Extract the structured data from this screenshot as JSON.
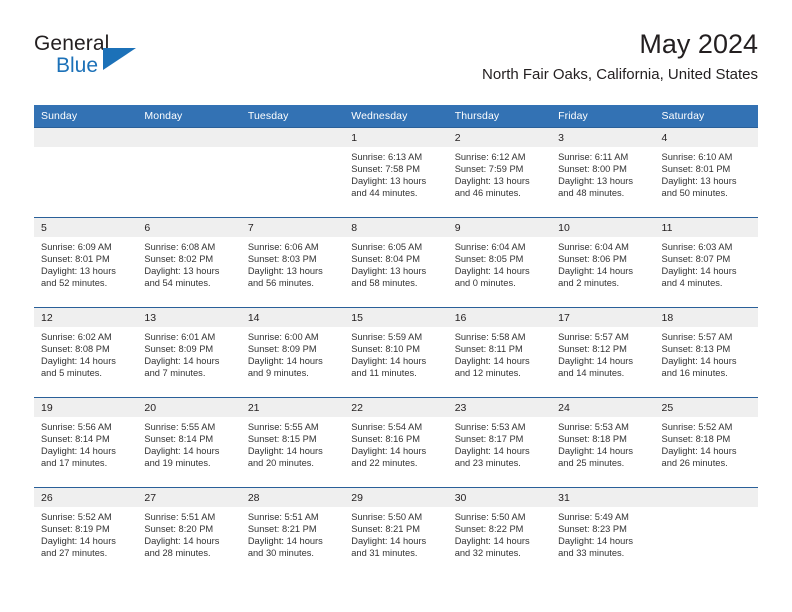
{
  "brand": {
    "name_part1": "General",
    "name_part2": "Blue"
  },
  "header": {
    "title": "May 2024",
    "subtitle": "North Fair Oaks, California, United States"
  },
  "colors": {
    "header_blue": "#3372b4",
    "row_border_blue": "#2a6099",
    "daynum_band": "#efefef",
    "brand_blue": "#1c71b8"
  },
  "weekdays": [
    "Sunday",
    "Monday",
    "Tuesday",
    "Wednesday",
    "Thursday",
    "Friday",
    "Saturday"
  ],
  "labels": {
    "sunrise": "Sunrise:",
    "sunset": "Sunset:",
    "daylight": "Daylight:"
  },
  "weeks": [
    [
      {
        "day": "",
        "sunrise": "",
        "sunset": "",
        "daylight": "",
        "empty": true
      },
      {
        "day": "",
        "sunrise": "",
        "sunset": "",
        "daylight": "",
        "empty": true
      },
      {
        "day": "",
        "sunrise": "",
        "sunset": "",
        "daylight": "",
        "empty": true
      },
      {
        "day": "1",
        "sunrise": "Sunrise: 6:13 AM",
        "sunset": "Sunset: 7:58 PM",
        "daylight": "Daylight: 13 hours and 44 minutes."
      },
      {
        "day": "2",
        "sunrise": "Sunrise: 6:12 AM",
        "sunset": "Sunset: 7:59 PM",
        "daylight": "Daylight: 13 hours and 46 minutes."
      },
      {
        "day": "3",
        "sunrise": "Sunrise: 6:11 AM",
        "sunset": "Sunset: 8:00 PM",
        "daylight": "Daylight: 13 hours and 48 minutes."
      },
      {
        "day": "4",
        "sunrise": "Sunrise: 6:10 AM",
        "sunset": "Sunset: 8:01 PM",
        "daylight": "Daylight: 13 hours and 50 minutes."
      }
    ],
    [
      {
        "day": "5",
        "sunrise": "Sunrise: 6:09 AM",
        "sunset": "Sunset: 8:01 PM",
        "daylight": "Daylight: 13 hours and 52 minutes."
      },
      {
        "day": "6",
        "sunrise": "Sunrise: 6:08 AM",
        "sunset": "Sunset: 8:02 PM",
        "daylight": "Daylight: 13 hours and 54 minutes."
      },
      {
        "day": "7",
        "sunrise": "Sunrise: 6:06 AM",
        "sunset": "Sunset: 8:03 PM",
        "daylight": "Daylight: 13 hours and 56 minutes."
      },
      {
        "day": "8",
        "sunrise": "Sunrise: 6:05 AM",
        "sunset": "Sunset: 8:04 PM",
        "daylight": "Daylight: 13 hours and 58 minutes."
      },
      {
        "day": "9",
        "sunrise": "Sunrise: 6:04 AM",
        "sunset": "Sunset: 8:05 PM",
        "daylight": "Daylight: 14 hours and 0 minutes."
      },
      {
        "day": "10",
        "sunrise": "Sunrise: 6:04 AM",
        "sunset": "Sunset: 8:06 PM",
        "daylight": "Daylight: 14 hours and 2 minutes."
      },
      {
        "day": "11",
        "sunrise": "Sunrise: 6:03 AM",
        "sunset": "Sunset: 8:07 PM",
        "daylight": "Daylight: 14 hours and 4 minutes."
      }
    ],
    [
      {
        "day": "12",
        "sunrise": "Sunrise: 6:02 AM",
        "sunset": "Sunset: 8:08 PM",
        "daylight": "Daylight: 14 hours and 5 minutes."
      },
      {
        "day": "13",
        "sunrise": "Sunrise: 6:01 AM",
        "sunset": "Sunset: 8:09 PM",
        "daylight": "Daylight: 14 hours and 7 minutes."
      },
      {
        "day": "14",
        "sunrise": "Sunrise: 6:00 AM",
        "sunset": "Sunset: 8:09 PM",
        "daylight": "Daylight: 14 hours and 9 minutes."
      },
      {
        "day": "15",
        "sunrise": "Sunrise: 5:59 AM",
        "sunset": "Sunset: 8:10 PM",
        "daylight": "Daylight: 14 hours and 11 minutes."
      },
      {
        "day": "16",
        "sunrise": "Sunrise: 5:58 AM",
        "sunset": "Sunset: 8:11 PM",
        "daylight": "Daylight: 14 hours and 12 minutes."
      },
      {
        "day": "17",
        "sunrise": "Sunrise: 5:57 AM",
        "sunset": "Sunset: 8:12 PM",
        "daylight": "Daylight: 14 hours and 14 minutes."
      },
      {
        "day": "18",
        "sunrise": "Sunrise: 5:57 AM",
        "sunset": "Sunset: 8:13 PM",
        "daylight": "Daylight: 14 hours and 16 minutes."
      }
    ],
    [
      {
        "day": "19",
        "sunrise": "Sunrise: 5:56 AM",
        "sunset": "Sunset: 8:14 PM",
        "daylight": "Daylight: 14 hours and 17 minutes."
      },
      {
        "day": "20",
        "sunrise": "Sunrise: 5:55 AM",
        "sunset": "Sunset: 8:14 PM",
        "daylight": "Daylight: 14 hours and 19 minutes."
      },
      {
        "day": "21",
        "sunrise": "Sunrise: 5:55 AM",
        "sunset": "Sunset: 8:15 PM",
        "daylight": "Daylight: 14 hours and 20 minutes."
      },
      {
        "day": "22",
        "sunrise": "Sunrise: 5:54 AM",
        "sunset": "Sunset: 8:16 PM",
        "daylight": "Daylight: 14 hours and 22 minutes."
      },
      {
        "day": "23",
        "sunrise": "Sunrise: 5:53 AM",
        "sunset": "Sunset: 8:17 PM",
        "daylight": "Daylight: 14 hours and 23 minutes."
      },
      {
        "day": "24",
        "sunrise": "Sunrise: 5:53 AM",
        "sunset": "Sunset: 8:18 PM",
        "daylight": "Daylight: 14 hours and 25 minutes."
      },
      {
        "day": "25",
        "sunrise": "Sunrise: 5:52 AM",
        "sunset": "Sunset: 8:18 PM",
        "daylight": "Daylight: 14 hours and 26 minutes."
      }
    ],
    [
      {
        "day": "26",
        "sunrise": "Sunrise: 5:52 AM",
        "sunset": "Sunset: 8:19 PM",
        "daylight": "Daylight: 14 hours and 27 minutes."
      },
      {
        "day": "27",
        "sunrise": "Sunrise: 5:51 AM",
        "sunset": "Sunset: 8:20 PM",
        "daylight": "Daylight: 14 hours and 28 minutes."
      },
      {
        "day": "28",
        "sunrise": "Sunrise: 5:51 AM",
        "sunset": "Sunset: 8:21 PM",
        "daylight": "Daylight: 14 hours and 30 minutes."
      },
      {
        "day": "29",
        "sunrise": "Sunrise: 5:50 AM",
        "sunset": "Sunset: 8:21 PM",
        "daylight": "Daylight: 14 hours and 31 minutes."
      },
      {
        "day": "30",
        "sunrise": "Sunrise: 5:50 AM",
        "sunset": "Sunset: 8:22 PM",
        "daylight": "Daylight: 14 hours and 32 minutes."
      },
      {
        "day": "31",
        "sunrise": "Sunrise: 5:49 AM",
        "sunset": "Sunset: 8:23 PM",
        "daylight": "Daylight: 14 hours and 33 minutes."
      },
      {
        "day": "",
        "sunrise": "",
        "sunset": "",
        "daylight": "",
        "empty": true
      }
    ]
  ]
}
